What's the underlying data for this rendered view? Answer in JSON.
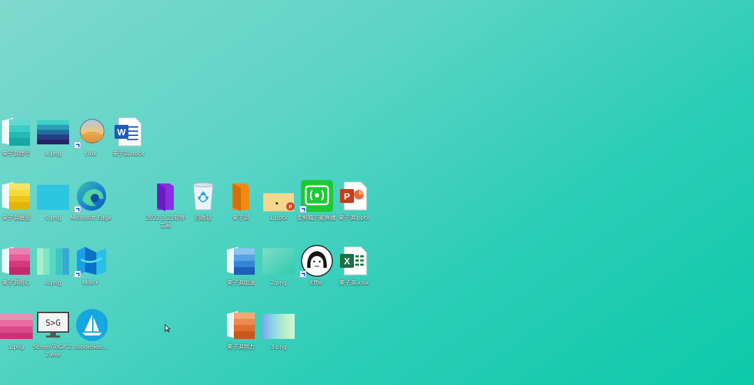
{
  "desktop": {
    "icons": {
      "folder_register": {
        "label": "来子淇登号",
        "color": "#2cc6bd"
      },
      "png4": {
        "label": "4.png"
      },
      "flux": {
        "label": "f.lux"
      },
      "word_doc": {
        "label": "来子淇.docx",
        "glyph": "W"
      },
      "folder_yellow": {
        "label": "来子淇敏感",
        "color": "#f2d21f"
      },
      "png5": {
        "label": "5.png",
        "color": "#2ec5e0"
      },
      "edge": {
        "label": "Microsoft Edge"
      },
      "folder_2022": {
        "label": "2022.3.21软件工具",
        "color": "#8a2fe0"
      },
      "recycle_bin": {
        "label": "回收站"
      },
      "folder_orange": {
        "label": "来子淇",
        "color": "#f28a12"
      },
      "pptx1": {
        "label": "1.pptx"
      },
      "live_stream": {
        "label": "爱剪辑万能直播"
      },
      "ppt_doc": {
        "label": "来子淇.pptx",
        "glyph": "P"
      },
      "folder_pink": {
        "label": "来子淇用心",
        "color": "#e0458a"
      },
      "png6": {
        "label": "6.png"
      },
      "miui": {
        "label": "MIUI+"
      },
      "folder_blue": {
        "label": "来子淇加油",
        "color": "#2f7bd6"
      },
      "png2": {
        "label": "2.png"
      },
      "effie": {
        "label": "Effie"
      },
      "excel_doc": {
        "label": "来子淇.xlsx",
        "glyph": "X"
      },
      "png1": {
        "label": "1.png"
      },
      "screentogif": {
        "label": "ScreenToGif 2.2.exe",
        "glyph": "S>G"
      },
      "coodesker": {
        "label": "coodesker..."
      },
      "folder_effort": {
        "label": "来子淇努力",
        "color": "#e66f2b"
      },
      "png3": {
        "label": "3.png"
      }
    }
  }
}
